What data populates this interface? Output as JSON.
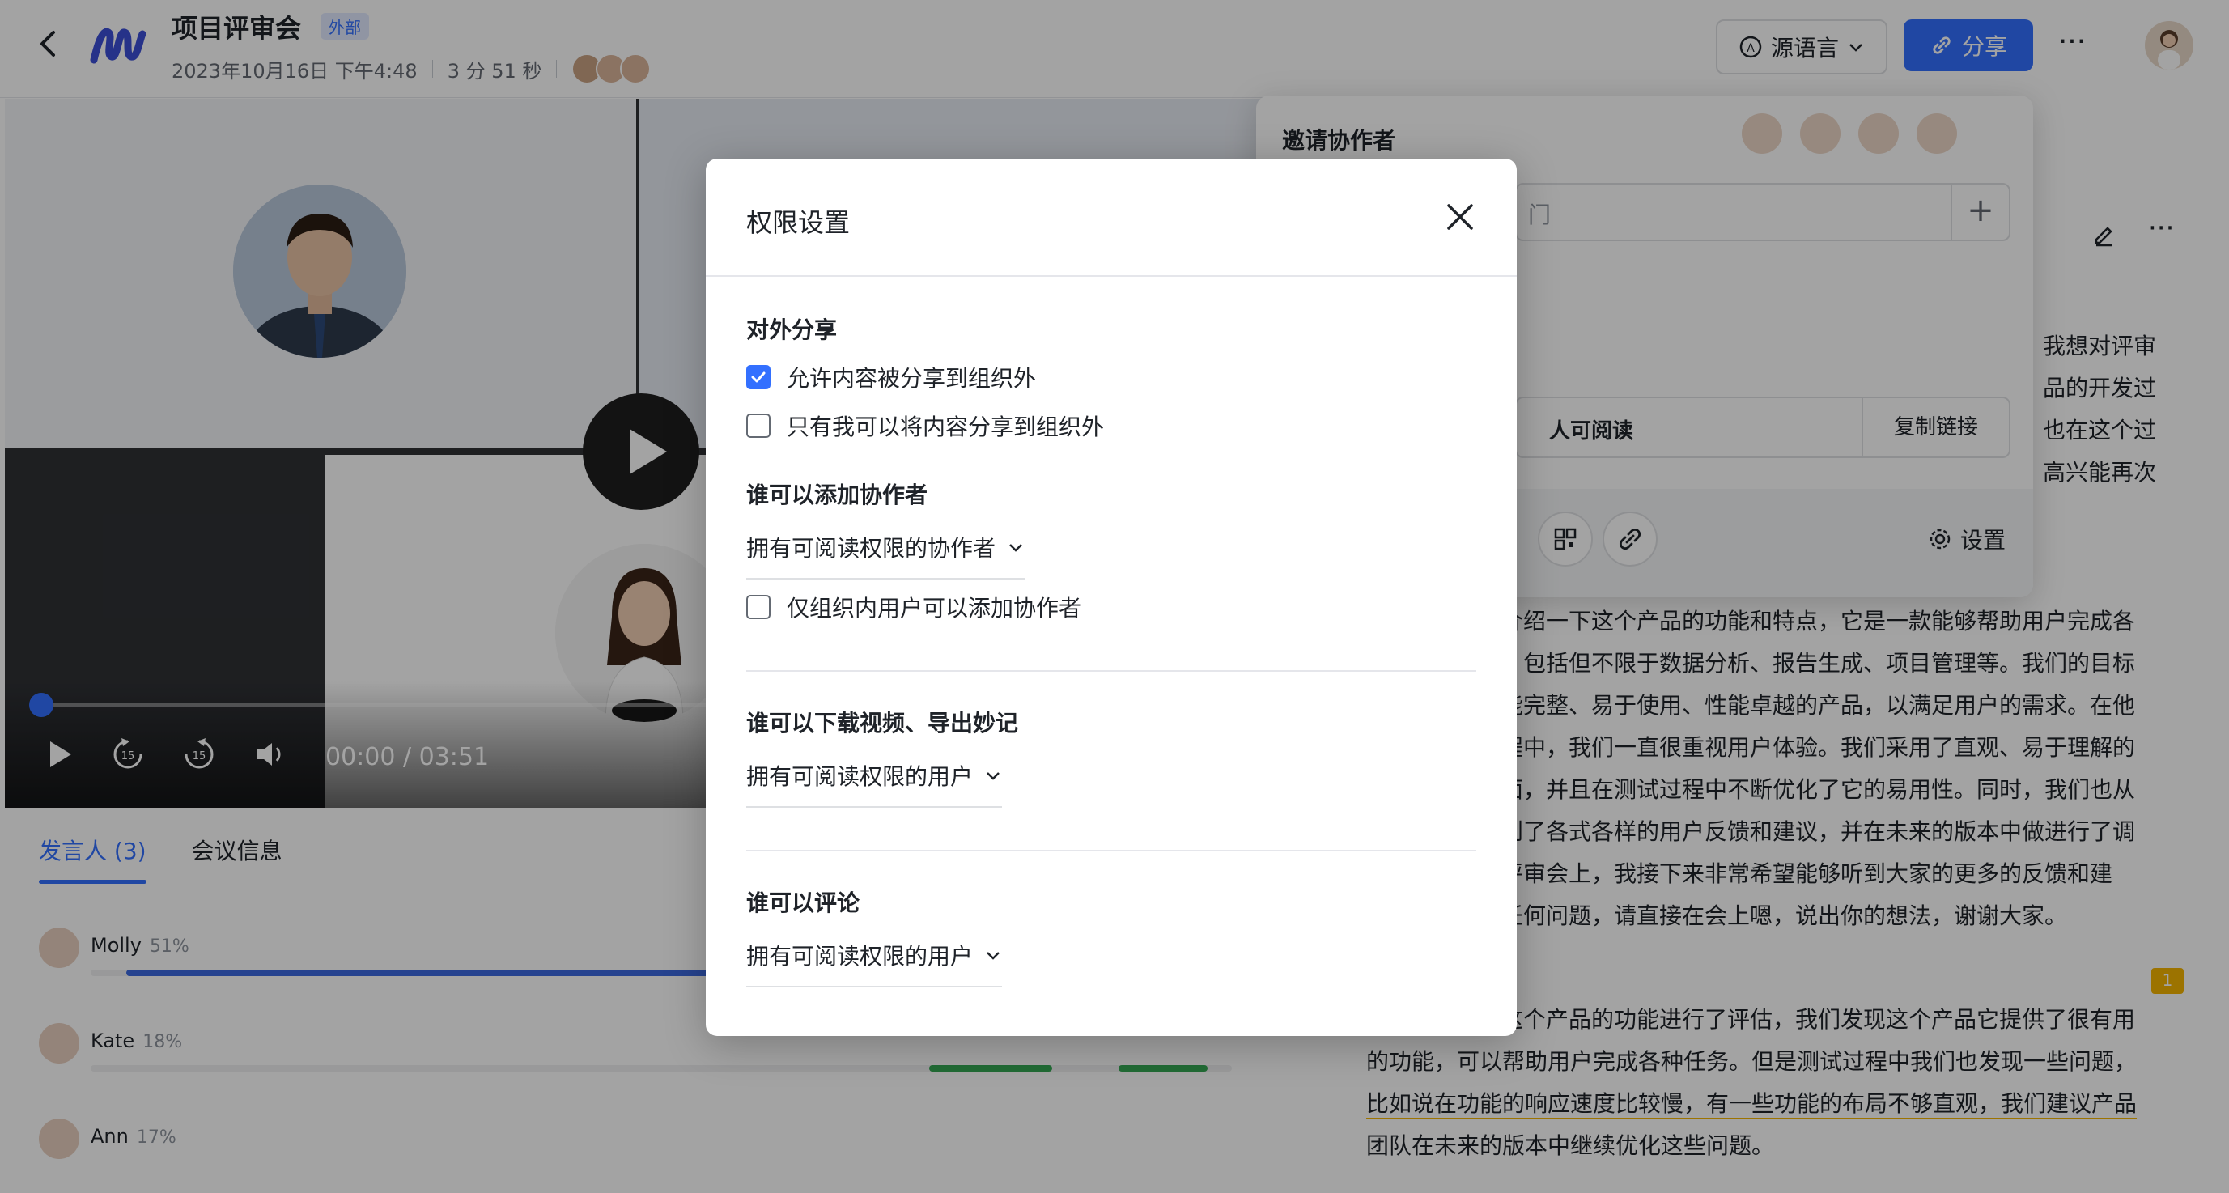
{
  "header": {
    "title": "项目评审会",
    "badge": "外部",
    "datetime": "2023年10月16日 下午4:48",
    "duration": "3 分 51 秒",
    "language_button": "源语言",
    "share_button": "分享",
    "more_label": "···"
  },
  "video": {
    "timecode": "00:00 / 03:51",
    "progress_fraction": 0.0
  },
  "tabs": [
    {
      "label": "发言人 (3)",
      "active": true
    },
    {
      "label": "会议信息",
      "active": false
    }
  ],
  "speakers": [
    {
      "name": "Molly",
      "percent": "51%"
    },
    {
      "name": "Kate",
      "percent": "18%"
    },
    {
      "name": "Ann",
      "percent": "17%"
    }
  ],
  "colors": {
    "accent": "#3370ff",
    "bar_blue": "#3c6ae0",
    "bar_green": "#34a853",
    "overlay": "rgba(0,0,0,0.36)"
  },
  "invite_popover": {
    "title": "邀请协作者",
    "input_placeholder": "门",
    "link_permission": "人可阅读",
    "copy_link": "复制链接",
    "settings": "设置"
  },
  "doc": {
    "para1_fragments": [
      "我想对评审",
      "品的开发过",
      "也在这个过",
      "高兴能再次"
    ],
    "para2_lines": [
      "介绍一下这个产品的功能和特点，它是一款能够帮助用户完成各",
      "，包括但不限于数据分析、报告生成、项目管理等。我们的目标",
      "能完整、易于使用、性能卓越的产品，以满足用户的需求。在他",
      "程中，我们一直很重视用户体验。我们采用了直观、易于理解的",
      "面，并且在测试过程中不断优化了它的易用性。同时，我们也从",
      "到了各式各样的用户反馈和建议，并在未来的版本中做进行了调",
      "评审会上，我接下来非常希望能够听到大家的更多的反馈和建",
      "任何问题，请直接在会上嗯，说出你的想法，谢谢大家。"
    ],
    "para3_lines": [
      "这个产品的功能进行了评估，我们发现这个产品它提供了很有用",
      "的功能，可以帮助用户完成各种任务。但是测试过程中我们也发现一些问题，",
      "比如说在功能的响应速度比较慢，有一些功能的布局不够直观，我们建议产品",
      "团队在未来的版本中继续优化这些问题。"
    ],
    "comment_count": "1"
  },
  "modal": {
    "title": "权限设置",
    "external_share": {
      "label": "对外分享",
      "option1": {
        "label": "允许内容被分享到组织外",
        "checked": true
      },
      "option2": {
        "label": "只有我可以将内容分享到组织外",
        "checked": false
      }
    },
    "add_collaborators": {
      "label": "谁可以添加协作者",
      "select": "拥有可阅读权限的协作者",
      "option": {
        "label": "仅组织内用户可以添加协作者",
        "checked": false
      }
    },
    "download": {
      "label": "谁可以下载视频、导出妙记",
      "select": "拥有可阅读权限的用户"
    },
    "comment": {
      "label": "谁可以评论",
      "select": "拥有可阅读权限的用户"
    }
  }
}
